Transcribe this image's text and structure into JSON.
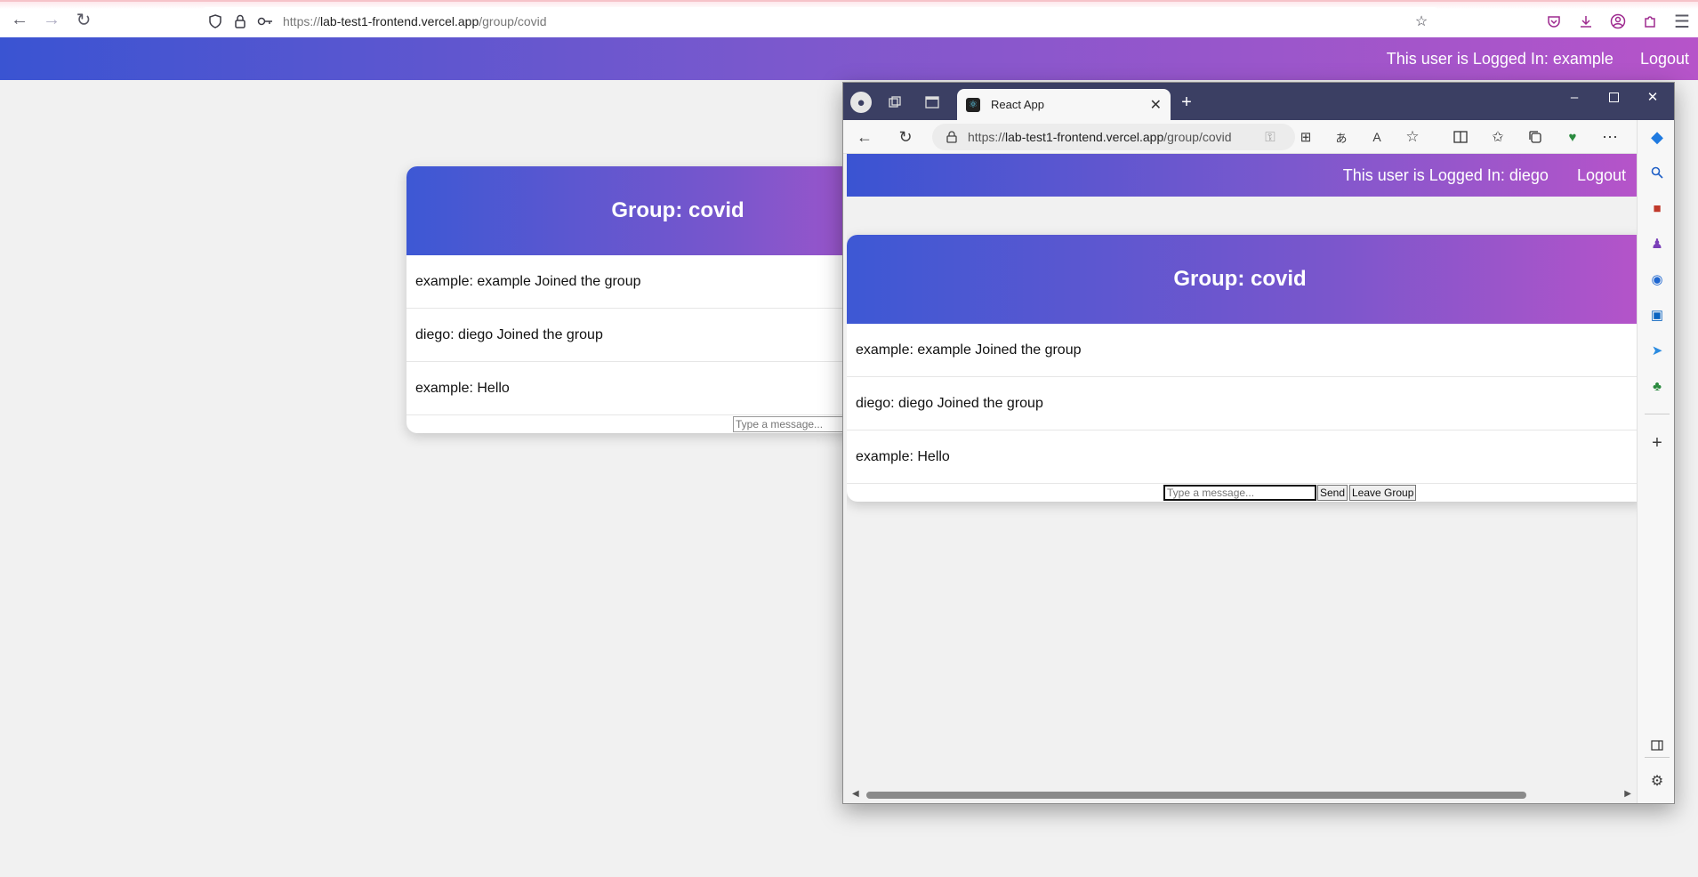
{
  "firefox": {
    "url_prefix": "https://",
    "url_host": "lab-test1-frontend.vercel.app",
    "url_path": "/group/covid"
  },
  "page1": {
    "header": {
      "user_text": "This user is Logged In: example",
      "logout_label": "Logout"
    },
    "group_title": "Group: covid",
    "messages": [
      "example: example Joined the group",
      "diego: diego Joined the group",
      "example: Hello"
    ],
    "input_placeholder": "Type a message..."
  },
  "edge": {
    "tab_title": "React App",
    "url_prefix": "https://",
    "url_host": "lab-test1-frontend.vercel.app",
    "url_path": "/group/covid",
    "page": {
      "header": {
        "user_text": "This user is Logged In: diego",
        "logout_label": "Logout"
      },
      "group_title": "Group: covid",
      "messages": [
        "example: example Joined the group",
        "diego: diego Joined the group",
        "example: Hello"
      ],
      "input_placeholder": "Type a message...",
      "send_label": "Send",
      "leave_label": "Leave Group"
    }
  },
  "colors": {
    "gradient_start": "#3a54d2",
    "gradient_end": "#b654c9",
    "edge_titlebar": "#3b3f63"
  }
}
